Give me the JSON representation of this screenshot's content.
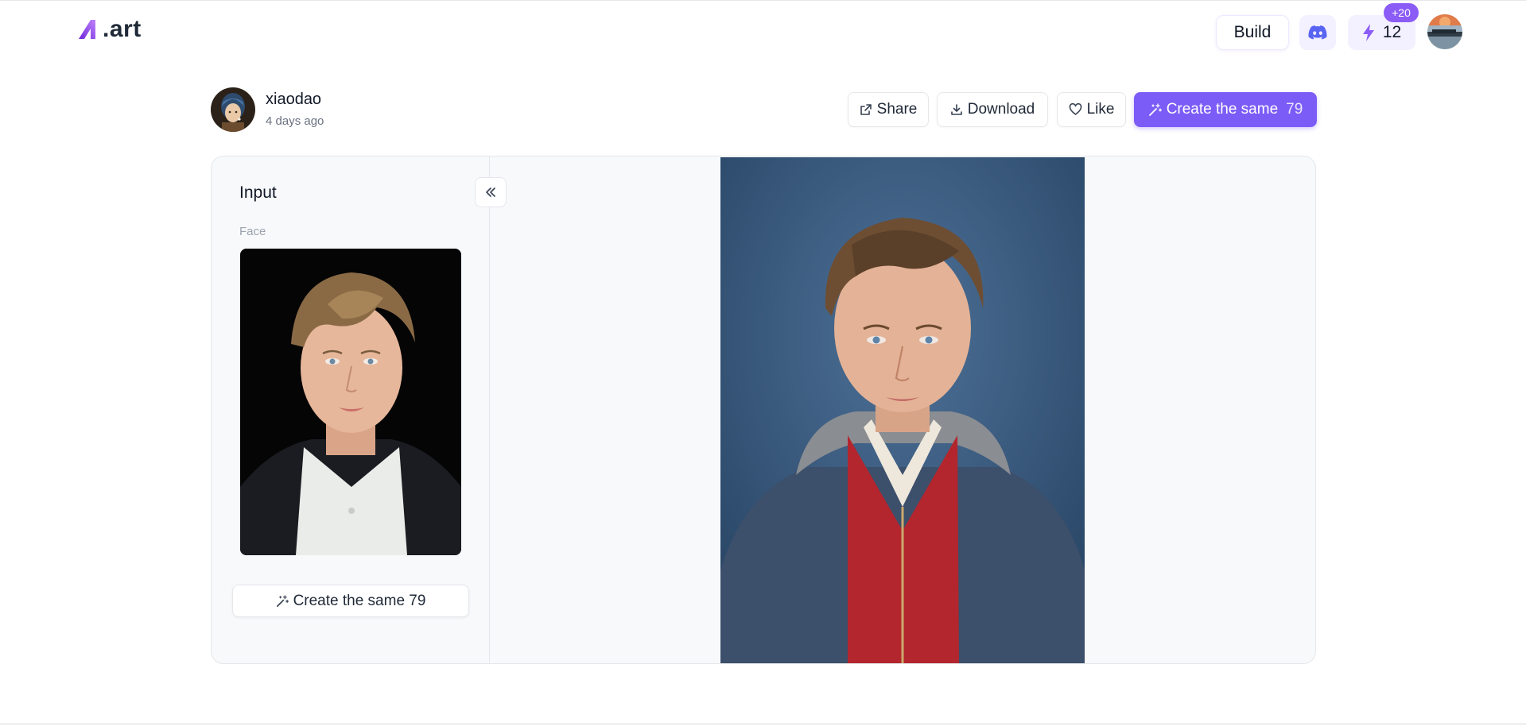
{
  "header": {
    "logo_text": ".art",
    "build_label": "Build",
    "discord_icon": "discord-icon",
    "credits": "12",
    "credits_bonus": "+20",
    "accent": "#7c5cf6"
  },
  "author": {
    "name": "xiaodao",
    "time": "4 days ago"
  },
  "actions": {
    "share": "Share",
    "download": "Download",
    "like": "Like",
    "create_label": "Create the same",
    "create_count": "79"
  },
  "input_panel": {
    "title": "Input",
    "face_label": "Face",
    "create_button": "Create the same 79"
  }
}
